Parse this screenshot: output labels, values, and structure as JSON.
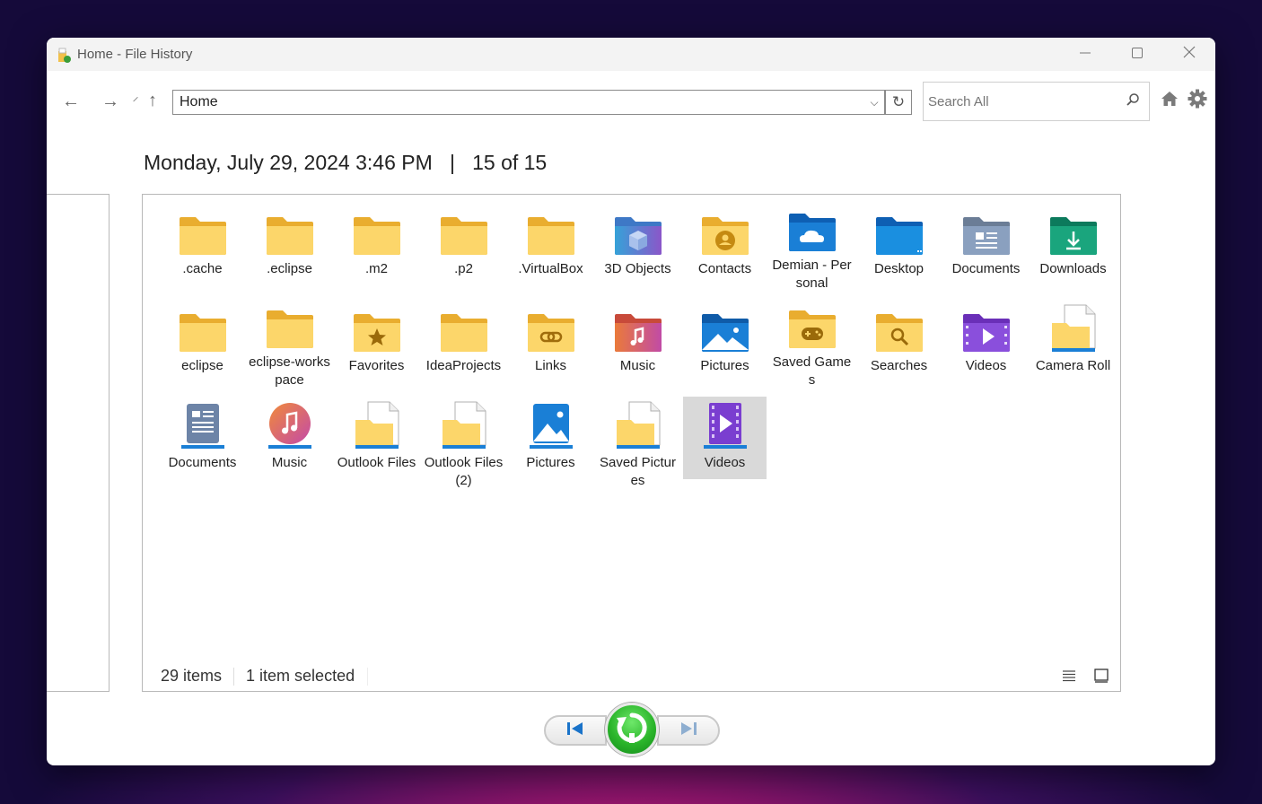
{
  "window": {
    "title": "Home - File History"
  },
  "controls": {
    "minimize": "—",
    "maximize": "☐",
    "close": "✕"
  },
  "nav": {
    "back": "←",
    "forward": "→",
    "recent": "⸍",
    "up": "↑",
    "address": "Home",
    "dropdown": "⌵",
    "refresh": "↻"
  },
  "search": {
    "placeholder": "Search All"
  },
  "header": {
    "date": "Monday, July 29, 2024 3:46 PM",
    "separator": "|",
    "position": "15 of 15"
  },
  "items": [
    {
      "label": ".cache",
      "icon": "folder-icon"
    },
    {
      "label": ".eclipse",
      "icon": "folder-icon"
    },
    {
      "label": ".m2",
      "icon": "folder-icon"
    },
    {
      "label": ".p2",
      "icon": "folder-icon"
    },
    {
      "label": ".VirtualBox",
      "icon": "folder-icon"
    },
    {
      "label": "3D Objects",
      "icon": "3d-objects-folder-icon"
    },
    {
      "label": "Contacts",
      "icon": "contacts-folder-icon"
    },
    {
      "label": "Demian - Personal",
      "icon": "onedrive-folder-icon"
    },
    {
      "label": "Desktop",
      "icon": "desktop-folder-icon"
    },
    {
      "label": "Documents",
      "icon": "documents-folder-icon"
    },
    {
      "label": "Downloads",
      "icon": "downloads-folder-icon"
    },
    {
      "label": "eclipse",
      "icon": "folder-icon"
    },
    {
      "label": "eclipse-workspace",
      "icon": "folder-icon"
    },
    {
      "label": "Favorites",
      "icon": "favorites-folder-icon"
    },
    {
      "label": "IdeaProjects",
      "icon": "folder-icon"
    },
    {
      "label": "Links",
      "icon": "links-folder-icon"
    },
    {
      "label": "Music",
      "icon": "music-folder-icon"
    },
    {
      "label": "Pictures",
      "icon": "pictures-folder-icon"
    },
    {
      "label": "Saved Games",
      "icon": "saved-games-folder-icon"
    },
    {
      "label": "Searches",
      "icon": "searches-folder-icon"
    },
    {
      "label": "Videos",
      "icon": "videos-folder-icon"
    },
    {
      "label": "Camera Roll",
      "icon": "file-folder-icon"
    },
    {
      "label": "Documents",
      "icon": "documents-library-icon"
    },
    {
      "label": "Music",
      "icon": "music-library-icon"
    },
    {
      "label": "Outlook Files",
      "icon": "file-folder-icon"
    },
    {
      "label": "Outlook Files (2)",
      "icon": "file-folder-icon"
    },
    {
      "label": "Pictures",
      "icon": "pictures-library-icon"
    },
    {
      "label": "Saved Pictures",
      "icon": "file-folder-icon"
    },
    {
      "label": "Videos",
      "icon": "videos-library-icon",
      "selected": true
    }
  ],
  "status": {
    "count": "29 items",
    "selection": "1 item selected"
  },
  "colors": {
    "folder": "#f7c843",
    "folder_light": "#fde38a",
    "accent": "#1a73c9",
    "restore_green": "#2bb52b"
  }
}
